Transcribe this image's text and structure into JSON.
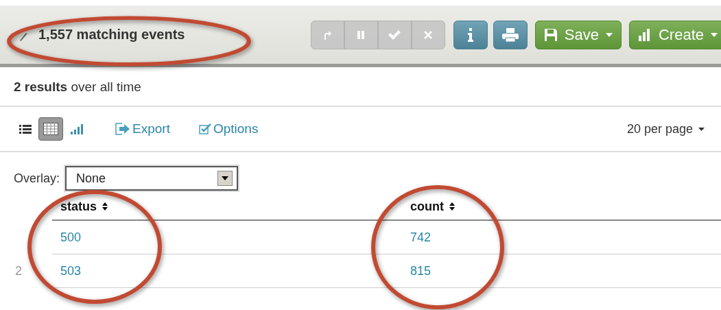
{
  "header": {
    "event_count": "1,557 matching events",
    "job_buttons": [
      {
        "kind": "send",
        "disabled": true
      },
      {
        "kind": "pause",
        "disabled": true
      },
      {
        "kind": "finalize",
        "disabled": true
      },
      {
        "kind": "cancel",
        "disabled": true
      }
    ],
    "action_buttons": [
      {
        "kind": "info"
      },
      {
        "kind": "print"
      }
    ],
    "menu_buttons": [
      {
        "kind": "save",
        "label": "Save"
      },
      {
        "kind": "create",
        "label": "Create"
      }
    ]
  },
  "summary": "**2 results** over all time",
  "toolbar": {
    "views": [
      {
        "kind": "list",
        "selected": false
      },
      {
        "kind": "table",
        "selected": true
      },
      {
        "kind": "chart",
        "selected": false
      }
    ],
    "links": [
      {
        "kind": "export",
        "label": "Export"
      },
      {
        "kind": "options",
        "label": "Options"
      }
    ],
    "per_page": "20 per page"
  },
  "overlay": {
    "label": "Overlay:",
    "value": "None"
  },
  "table": {
    "columns": [
      "status",
      "count"
    ],
    "rows": [
      {
        "cells": [
          "500",
          "742"
        ]
      },
      {
        "row_number": "2",
        "cells": [
          "503",
          "815"
        ]
      }
    ]
  }
}
